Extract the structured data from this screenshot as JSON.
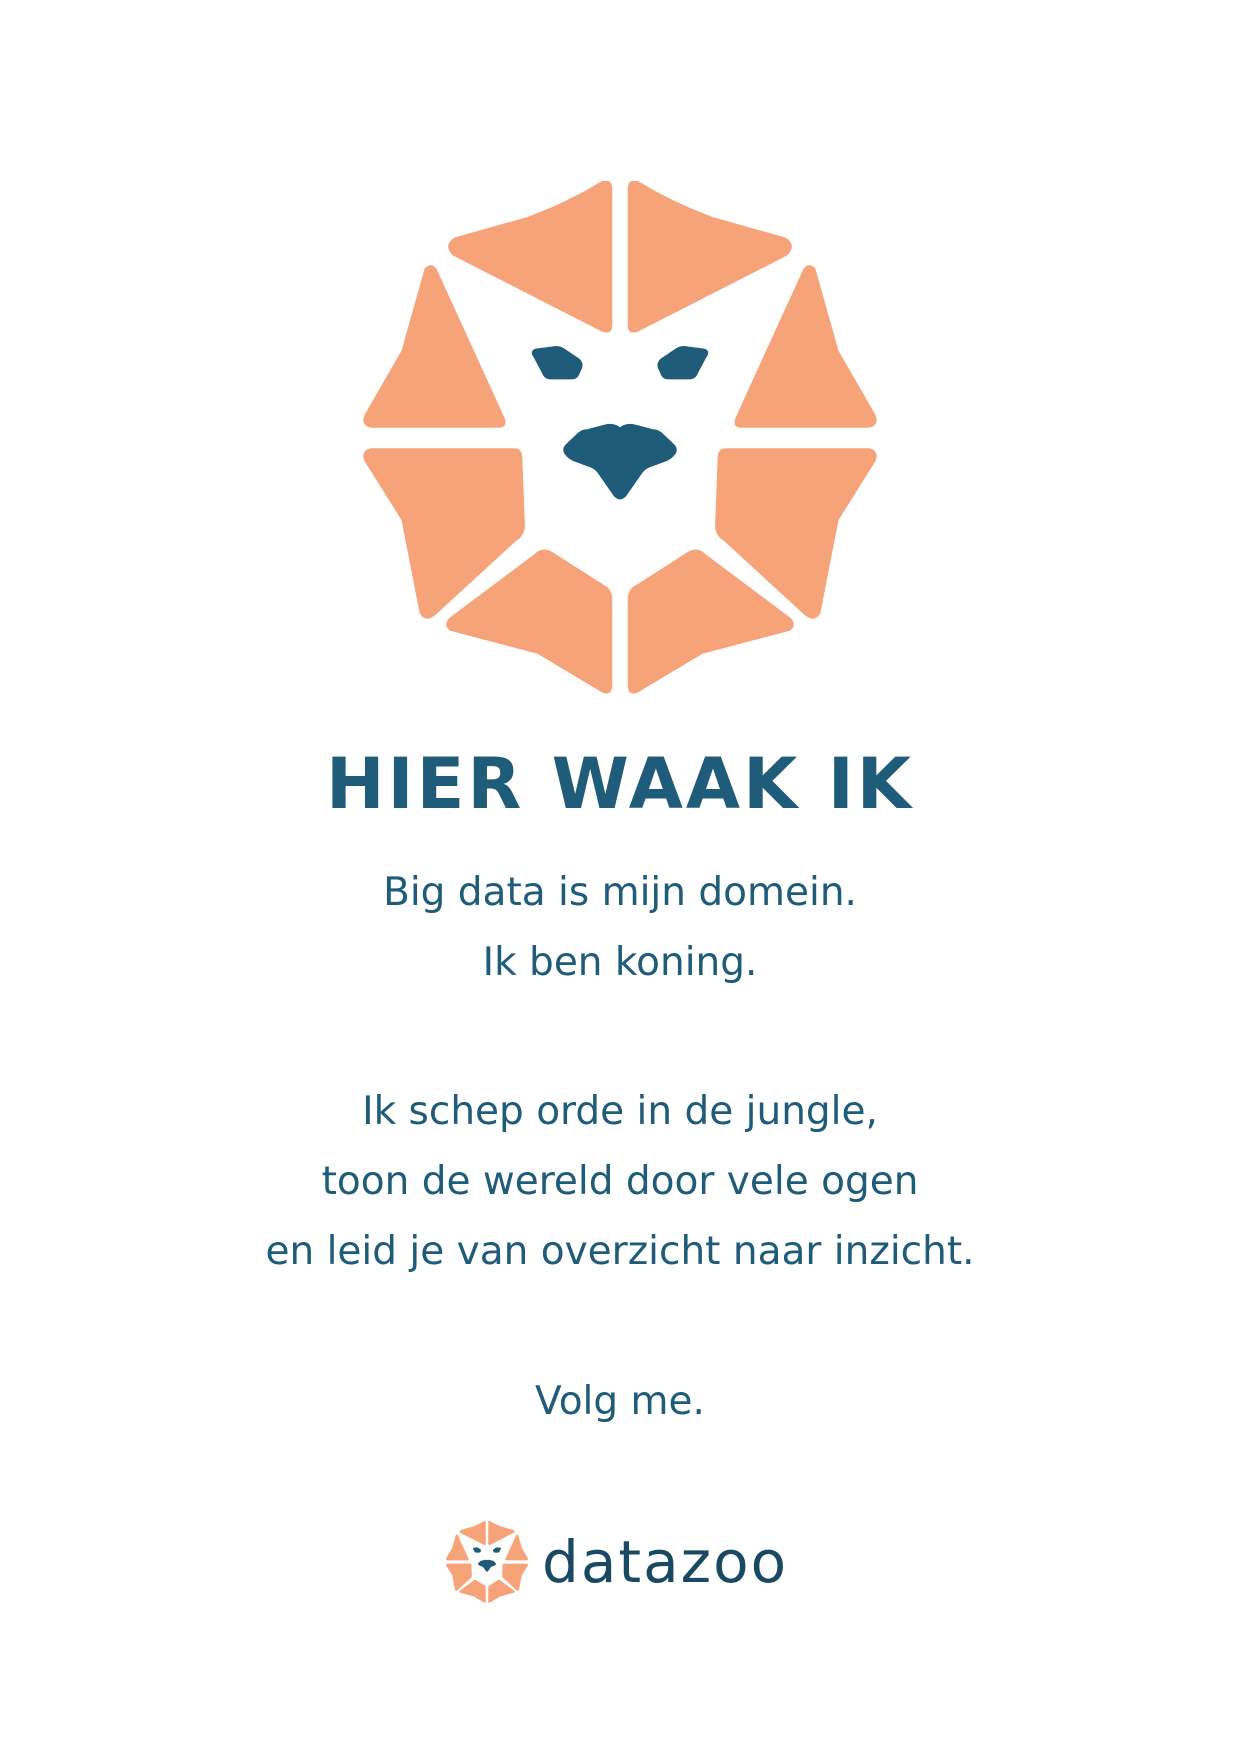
{
  "headline": "HIER WAAK IK",
  "poem": {
    "stanza_1": [
      "Big data is mijn domein.",
      "Ik ben koning."
    ],
    "stanza_2": [
      "Ik schep orde in de jungle,",
      "toon de wereld door vele ogen",
      "en leid je van overzicht naar inzicht."
    ],
    "stanza_3": [
      "Volg me."
    ]
  },
  "brand": {
    "name": "datazoo"
  },
  "colors": {
    "mane": "#f7a37a",
    "face_features": "#1f5c7a",
    "text": "#1f5c7a",
    "brand_text": "#1a4a63",
    "background": "#ffffff"
  },
  "icons": {
    "main_logo": "lion-head-icon",
    "brand_logo": "lion-head-icon"
  }
}
